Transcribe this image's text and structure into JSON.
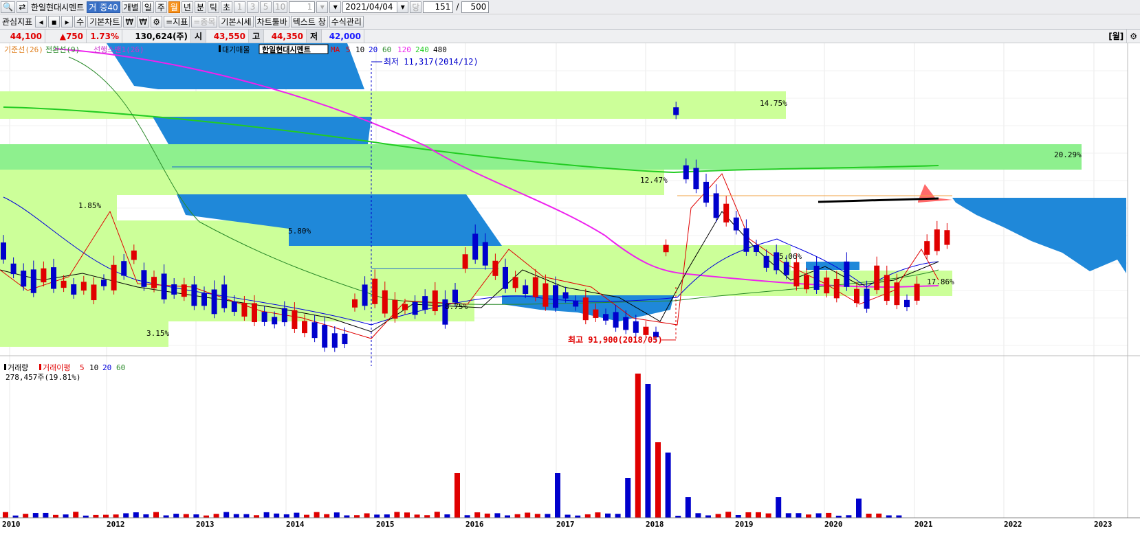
{
  "toolbar1": {
    "stock_name": "한일현대시멘트",
    "badge1": "거",
    "badge2": "증40",
    "btn_individual": "개별",
    "periods": [
      "일",
      "주",
      "월",
      "년",
      "분",
      "틱",
      "초"
    ],
    "selected_period": "월",
    "nums": [
      "1",
      "3",
      "5",
      "10"
    ],
    "interval_value": "1",
    "date": "2021/04/04",
    "label_dang": "당",
    "count": "151",
    "slash": "/",
    "total": "500"
  },
  "toolbar2": {
    "interest": "관심지표",
    "basic_chart": "기본차트",
    "indicator": "=지표",
    "item": "=종목",
    "basic_quote": "기본시세",
    "chart_toolbar": "차트툴바",
    "text_flow": "텍스트 창",
    "formula": "수식관리"
  },
  "pricebar": {
    "current": "44,100",
    "change": "▲750",
    "pct": "1.73%",
    "volume": "130,624(주)",
    "open_label": "시",
    "open": "43,550",
    "high_label": "고",
    "high": "44,350",
    "low_label": "저",
    "low": "42,000",
    "period_label": "[월]"
  },
  "colors": {
    "up": "#e00000",
    "down": "#0000cc",
    "cloud": "#1f88d9",
    "profile": "#ccff99",
    "profile_hi": "#8ef08e",
    "ma120": "#ee22ee",
    "ma240": "#22cc22"
  },
  "price_legend": {
    "ichimoku": [
      "기준선(26)",
      "전환선(9)",
      "선행스팬1(26)"
    ],
    "vp_label": "대기매물",
    "name": "한일현대시멘트",
    "ma_label": "MA",
    "ma_periods": [
      "5",
      "10",
      "20",
      "60",
      "120",
      "240",
      "480"
    ]
  },
  "annotations": {
    "low": "최저 11,317(2014/12)",
    "high": "최고 91,900(2018/05)"
  },
  "profile_pct": [
    "14.75%",
    "20.29%",
    "12.47%",
    "1.85%",
    "5.80%",
    "5.06%",
    "17.86%",
    "8.75%",
    "3.15%"
  ],
  "volume_legend": {
    "label": "거래량",
    "ma_label": "거래이평",
    "ma_periods": [
      "5",
      "10",
      "20",
      "60"
    ],
    "value": "278,457주(19.81%)"
  },
  "x_axis": [
    "2010",
    "2012",
    "2013",
    "2014",
    "2015",
    "2016",
    "2017",
    "2018",
    "2019",
    "2020",
    "2021",
    "2022",
    "2023"
  ],
  "chart_data": {
    "type": "candlestick",
    "interval": "monthly",
    "price_extremes": {
      "low": 11317,
      "low_date": "2014/12",
      "high": 91900,
      "high_date": "2018/05"
    },
    "last_bar": {
      "open": 43550,
      "high": 44350,
      "low": 42000,
      "close": 44100
    }
  }
}
